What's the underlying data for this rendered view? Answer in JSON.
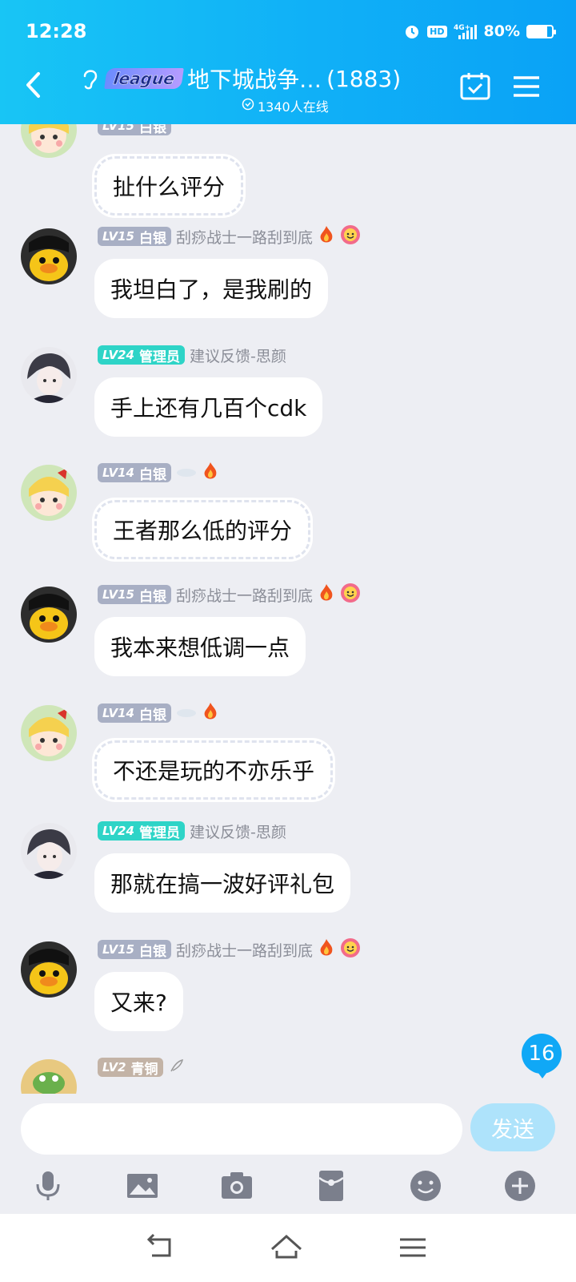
{
  "status_bar": {
    "time": "12:28",
    "hd": "HD",
    "network": "4G+",
    "battery": "80%",
    "battery_level": 0.8
  },
  "header": {
    "logo_text": "league",
    "title": "地下城战争…",
    "count": "(1883)",
    "online": "1340人在线"
  },
  "messages": [
    {
      "level": "LV15",
      "rank": "白银",
      "rank_style": "silver",
      "user_title": "",
      "text": "扯什么评分",
      "fancy": true
    },
    {
      "level": "LV15",
      "rank": "白银",
      "rank_style": "silver",
      "user_title": "刮痧战士一路刮到底",
      "text": "我坦白了，是我刷的",
      "fancy": false
    },
    {
      "level": "LV24",
      "rank": "管理员",
      "rank_style": "admin",
      "user_title": "建议反馈-思颜",
      "text": "手上还有几百个cdk",
      "fancy": false
    },
    {
      "level": "LV14",
      "rank": "白银",
      "rank_style": "silver",
      "user_title": "",
      "text": "王者那么低的评分",
      "fancy": true
    },
    {
      "level": "LV15",
      "rank": "白银",
      "rank_style": "silver",
      "user_title": "刮痧战士一路刮到底",
      "text": "我本来想低调一点",
      "fancy": false
    },
    {
      "level": "LV14",
      "rank": "白银",
      "rank_style": "silver",
      "user_title": "",
      "text": "不还是玩的不亦乐乎",
      "fancy": true
    },
    {
      "level": "LV24",
      "rank": "管理员",
      "rank_style": "admin",
      "user_title": "建议反馈-思颜",
      "text": "那就在搞一波好评礼包",
      "fancy": false
    },
    {
      "level": "LV15",
      "rank": "白银",
      "rank_style": "silver",
      "user_title": "刮痧战士一路刮到底",
      "text": "又来?",
      "fancy": false
    },
    {
      "level": "LV2",
      "rank": "青铜",
      "rank_style": "bronze",
      "user_title": "",
      "text": "",
      "fancy": false
    }
  ],
  "unread_count": "16",
  "input": {
    "placeholder": "",
    "send_label": "发送"
  },
  "toolbar_icons": [
    "microphone-icon",
    "image-icon",
    "camera-icon",
    "red-packet-icon",
    "emoji-icon",
    "plus-icon"
  ],
  "colors": {
    "header_start": "#18c5f5",
    "header_end": "#0aa2f6",
    "admin": "#2ed4c7",
    "silver": "#a8afc4",
    "unread": "#10a8f6",
    "send": "#aee3fb"
  }
}
